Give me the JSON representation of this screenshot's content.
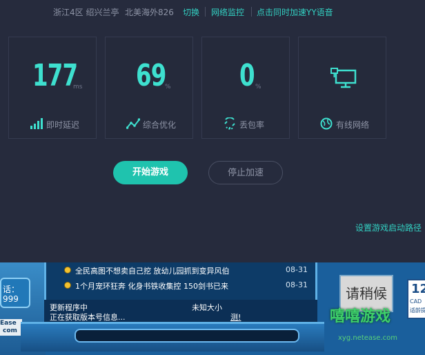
{
  "topbar": {
    "server": "浙江4区 绍兴兰亭",
    "node": "北美海外826",
    "switch": "切换",
    "monitor": "网络监控",
    "yy": "点击同时加速YY语音"
  },
  "cards": [
    {
      "value": "177",
      "unit": "ms",
      "label": "即时延迟",
      "icon": "signal-bars-icon"
    },
    {
      "value": "69",
      "unit": "%",
      "label": "综合优化",
      "icon": "trend-line-icon"
    },
    {
      "value": "0",
      "unit": "%",
      "label": "丢包率",
      "icon": "packet-loss-icon"
    },
    {
      "value": "",
      "unit": "",
      "label": "有线网络",
      "icon": "wired-network-icon"
    }
  ],
  "buttons": {
    "start": "开始游戏",
    "stop": "停止加速"
  },
  "settings_link": "设置游戏启动路径",
  "colors": {
    "accent": "#33d0c2",
    "start_button": "#1fc3ae",
    "panel_bg": "#262b3d"
  },
  "game": {
    "news": [
      {
        "title": "全民高图不想卖自己挖 放幼儿园抓到变异风伯",
        "date": "08-31"
      },
      {
        "title": "1个月宠环狂奔 化身书铁收集控 150剑书已来",
        "date": "08-31"
      }
    ],
    "status_line1": "更新程序中",
    "status_size": "未知大小",
    "status_line2": "正在获取版本号信息...",
    "status_link": "测!",
    "wait_button": "请稍候",
    "left_badge_line1": "话：",
    "left_badge_line2": "999",
    "brand": "Ease",
    "brand2": "com",
    "right_badge": "12",
    "right_badge_sub1": "CAD",
    "right_badge_sub2": "适龄提",
    "watermark": "嘻嘻游戏",
    "watermark_url": "xyg.netease.com"
  }
}
